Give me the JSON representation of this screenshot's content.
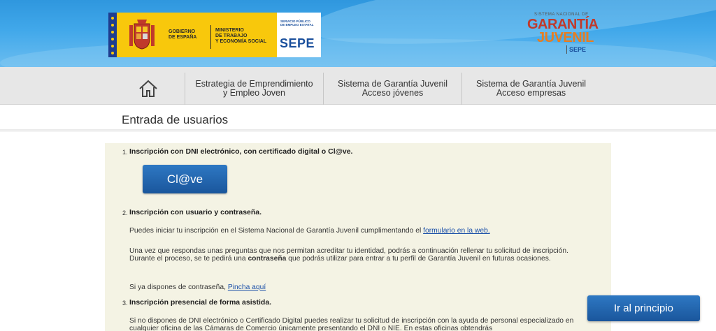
{
  "header": {
    "gov_line1": "GOBIERNO",
    "gov_line2": "DE ESPAÑA",
    "ministry_line1": "MINISTERIO",
    "ministry_line2": "DE TRABAJO",
    "ministry_line3": "Y ECONOMÍA SOCIAL",
    "sepe_small1": "SERVICIO PÚBLICO",
    "sepe_small2": "DE EMPLEO ESTATAL",
    "sepe_big": "SEPE",
    "sngj_top": "SISTEMA NACIONAL DE",
    "sngj_line1": "GARANTÍA",
    "sngj_line2": "JUVENIL",
    "sngj_sepe": "SEPE",
    "colors": {
      "banner": "#41a8ea",
      "gov_yellow": "#f8c80c",
      "eu_blue": "#1f3d8f",
      "sepe_blue": "#1a4f9c"
    }
  },
  "nav": {
    "home_icon": "home-icon",
    "items": [
      {
        "label": "Estrategia de Emprendimiento\ny Empleo Joven"
      },
      {
        "label": "Sistema de Garantía Juvenil\nAcceso jóvenes"
      },
      {
        "label": "Sistema de Garantía Juvenil\nAcceso empresas"
      }
    ]
  },
  "page": {
    "title": "Entrada de usuarios"
  },
  "content": {
    "s1": {
      "num": "1.",
      "heading": "Inscripción con DNI electrónico, con certificado digital o Cl@ve.",
      "button": "Cl@ve"
    },
    "s2": {
      "num": "2.",
      "heading": "Inscripción con usuario y contraseña.",
      "p1_text": "Puedes iniciar tu inscripción en el Sistema Nacional de Garantía Juvenil cumplimentando el ",
      "p1_link": "formulario en la web.",
      "p2_text_a": "Una vez que respondas unas preguntas que nos permitan acreditar tu identidad, podrás a continuación rellenar tu solicitud de inscripción. Durante el proceso, se te pedirá una ",
      "p2_bold": "contraseña",
      "p2_text_b": " que podrás utilizar para entrar a tu perfil de Garantía Juvenil en futuras ocasiones.",
      "p3_text": "Si ya dispones de contraseña, ",
      "p3_link": "Pincha aquí"
    },
    "s3": {
      "num": "3.",
      "heading": "Inscripción presencial de forma asistida.",
      "p1_text": "Si no dispones de DNI electrónico o Certificado Digital puedes realizar tu solicitud de inscripción con la ayuda de personal especializado en cualquier oficina de las Cámaras de Comercio únicamente presentando el DNI o NIE. En estas oficinas obtendrás"
    }
  },
  "back_to_top": "Ir al principio"
}
